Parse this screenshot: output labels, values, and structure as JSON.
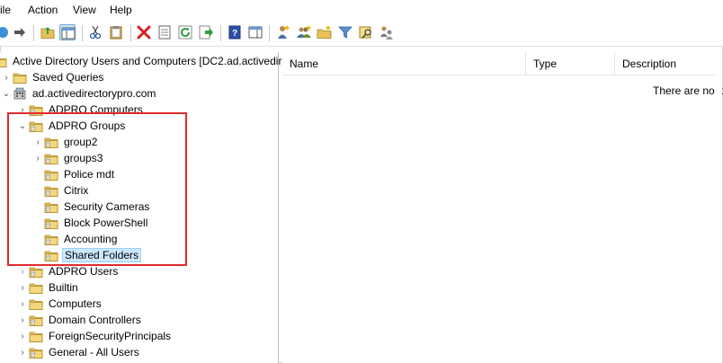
{
  "menu": {
    "file": "ile",
    "action": "Action",
    "view": "View",
    "help": "Help"
  },
  "toolbar": {
    "buttons": [
      "back-icon",
      "forward-icon",
      "up-folder-icon",
      "show-tree-icon",
      "cut-icon",
      "clipboard-icon",
      "delete-icon",
      "properties-icon",
      "refresh-icon",
      "export-icon",
      "help-icon",
      "console-icon",
      "new-user-icon",
      "new-group-icon",
      "new-ou-icon",
      "filter-icon",
      "find-icon",
      "add-to-group-icon"
    ]
  },
  "tree": {
    "root": "Active Directory Users and Computers [DC2.ad.activedir",
    "saved_queries": "Saved Queries",
    "domain": "ad.activedirectorypro.com",
    "nodes": {
      "adpro_computers": "ADPRO Computers",
      "adpro_groups": "ADPRO Groups",
      "group2": "group2",
      "groups3": "groups3",
      "police_mdt": "Police mdt",
      "citrix": "Citrix",
      "security_cameras": "Security Cameras",
      "block_powershell": "Block PowerShell",
      "accounting": "Accounting",
      "shared_folders": "Shared Folders",
      "adpro_users": "ADPRO Users",
      "builtin": "Builtin",
      "computers": "Computers",
      "domain_controllers": "Domain Controllers",
      "foreign_security_principals": "ForeignSecurityPrincipals",
      "general_all_users": "General - All Users"
    }
  },
  "list": {
    "columns": {
      "name": "Name",
      "type": "Type",
      "description": "Description"
    },
    "empty_message": "There are no it"
  },
  "colors": {
    "highlight_box": "#e02b2b",
    "selection": "#cce8ff",
    "folder": "#e8c15a"
  }
}
